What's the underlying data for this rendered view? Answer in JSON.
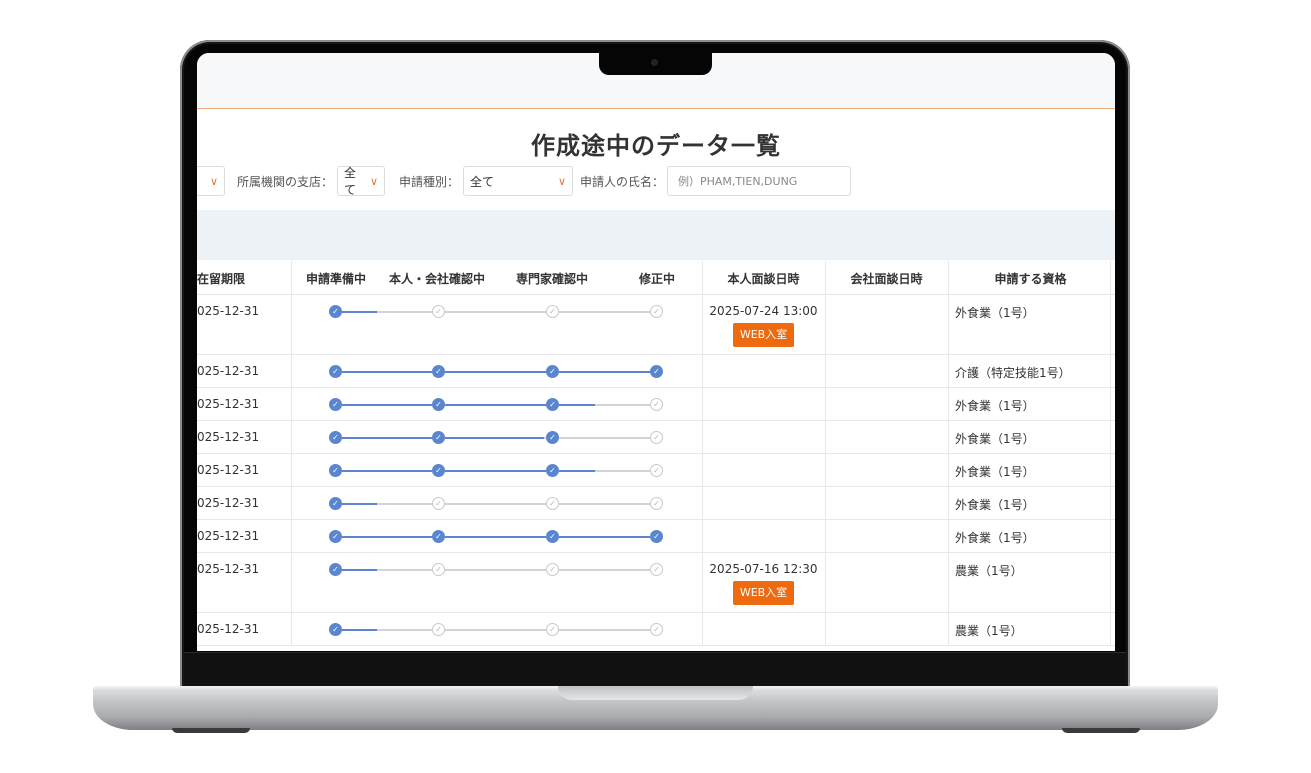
{
  "page": {
    "title": "作成途中のデータ一覧"
  },
  "filters": {
    "branch_label": "所属機関の支店：",
    "branch_value": "全て",
    "type_label": "申請種別：",
    "type_value": "全て",
    "name_label": "申請人の氏名：",
    "name_placeholder": "例）PHAM,TIEN,DUNG"
  },
  "table": {
    "headers": {
      "expiry": "在留期限",
      "prep": "申請準備中",
      "self_company": "本人・会社確認中",
      "expert": "専門家確認中",
      "fixing": "修正中",
      "personal_interview": "本人面談日時",
      "company_interview": "会社面談日時",
      "qualification": "申請する資格"
    },
    "web_button_label": "WEB入室",
    "rows": [
      {
        "expiry": "025-12-31",
        "progress": 0.15,
        "interview": "2025-07-24 13:00",
        "web": true,
        "qualification": "外食業（1号）"
      },
      {
        "expiry": "025-12-31",
        "progress": 1.0,
        "interview": "",
        "web": false,
        "qualification": "介護（特定技能1号）"
      },
      {
        "expiry": "025-12-31",
        "progress": 0.83,
        "interview": "",
        "web": false,
        "qualification": "外食業（1号）"
      },
      {
        "expiry": "025-12-31",
        "progress": 0.67,
        "interview": "",
        "web": false,
        "qualification": "外食業（1号）"
      },
      {
        "expiry": "025-12-31",
        "progress": 0.83,
        "interview": "",
        "web": false,
        "qualification": "外食業（1号）"
      },
      {
        "expiry": "025-12-31",
        "progress": 0.15,
        "interview": "",
        "web": false,
        "qualification": "外食業（1号）"
      },
      {
        "expiry": "025-12-31",
        "progress": 1.0,
        "interview": "",
        "web": false,
        "qualification": "外食業（1号）"
      },
      {
        "expiry": "025-12-31",
        "progress": 0.15,
        "interview": "2025-07-16 12:30",
        "web": true,
        "qualification": "農業（1号）"
      },
      {
        "expiry": "025-12-31",
        "progress": 0.15,
        "interview": "",
        "web": false,
        "qualification": "農業（1号）"
      }
    ]
  },
  "icons": {
    "check": "check-icon",
    "chevron": "chevron-down-icon"
  },
  "colors": {
    "accent_orange": "#ee6a10",
    "progress_blue": "#5b86cf",
    "filter_bar": "#edf2f7"
  }
}
